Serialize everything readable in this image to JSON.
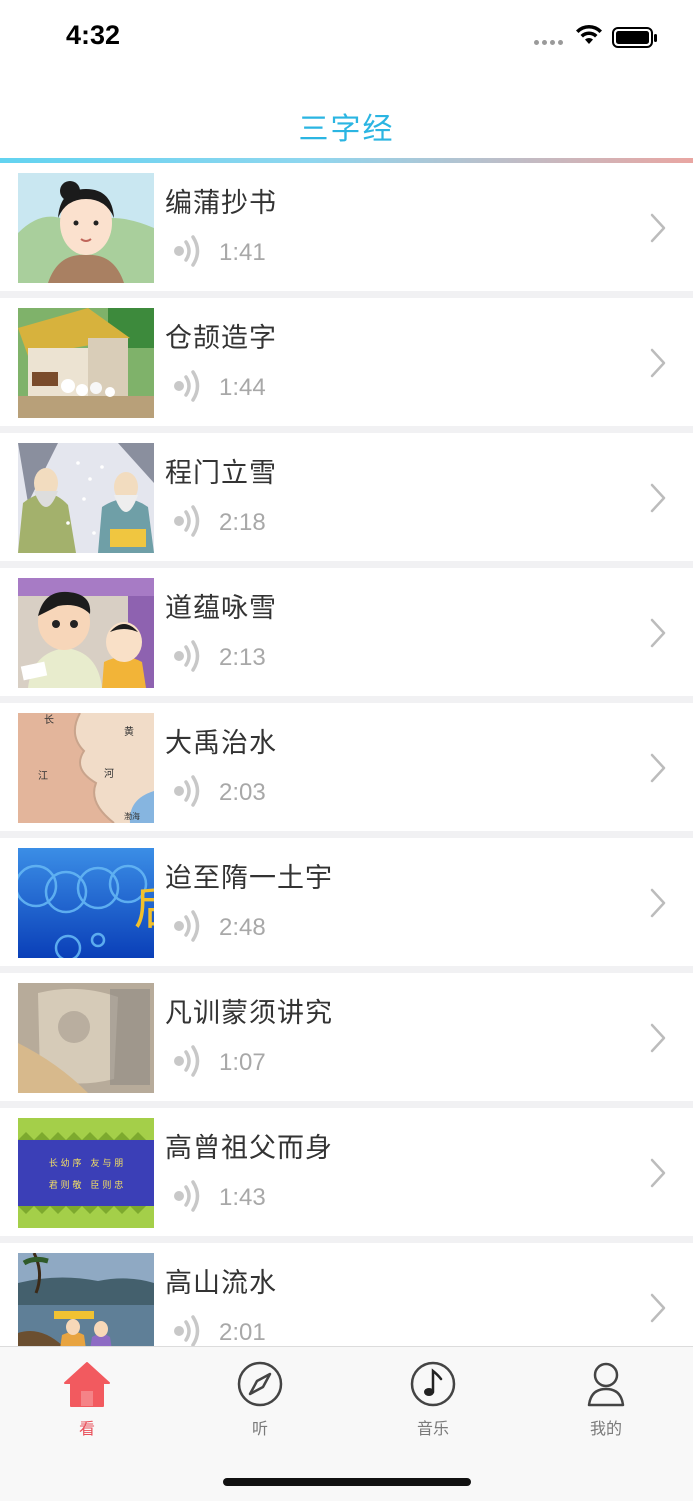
{
  "status_bar": {
    "time": "4:32"
  },
  "nav": {
    "title": "三字经"
  },
  "colors": {
    "accent": "#2bb5e2",
    "active_tab": "#e9505a",
    "inactive_tab": "#7a7a7a"
  },
  "items": [
    {
      "title": "编蒲抄书",
      "duration": "1:41",
      "thumb": "girl-portrait"
    },
    {
      "title": "仓颉造字",
      "duration": "1:44",
      "thumb": "farmhouse-animals"
    },
    {
      "title": "程门立雪",
      "duration": "2:18",
      "thumb": "scholars-in-snow"
    },
    {
      "title": "道蕴咏雪",
      "duration": "2:13",
      "thumb": "two-children"
    },
    {
      "title": "大禹治水",
      "duration": "2:03",
      "thumb": "river-map",
      "map_labels": [
        "长",
        "黄",
        "江",
        "河",
        "渤海"
      ]
    },
    {
      "title": "迨至隋一土宇",
      "duration": "2:48",
      "thumb": "blue-circles",
      "glyph": "后"
    },
    {
      "title": "凡训蒙须讲究",
      "duration": "1:07",
      "thumb": "faded-scroll"
    },
    {
      "title": "高曾祖父而身",
      "duration": "1:43",
      "thumb": "text-banner",
      "banner_lines": [
        "长 幼 序　友 与 朋",
        "君 则 敬　臣 则 忠"
      ]
    },
    {
      "title": "高山流水",
      "duration": "2:01",
      "thumb": "lake-musicians"
    }
  ],
  "tabs": [
    {
      "label": "看",
      "icon": "home-icon",
      "active": true
    },
    {
      "label": "听",
      "icon": "compass-icon",
      "active": false
    },
    {
      "label": "音乐",
      "icon": "music-note-icon",
      "active": false
    },
    {
      "label": "我的",
      "icon": "user-icon",
      "active": false
    }
  ]
}
